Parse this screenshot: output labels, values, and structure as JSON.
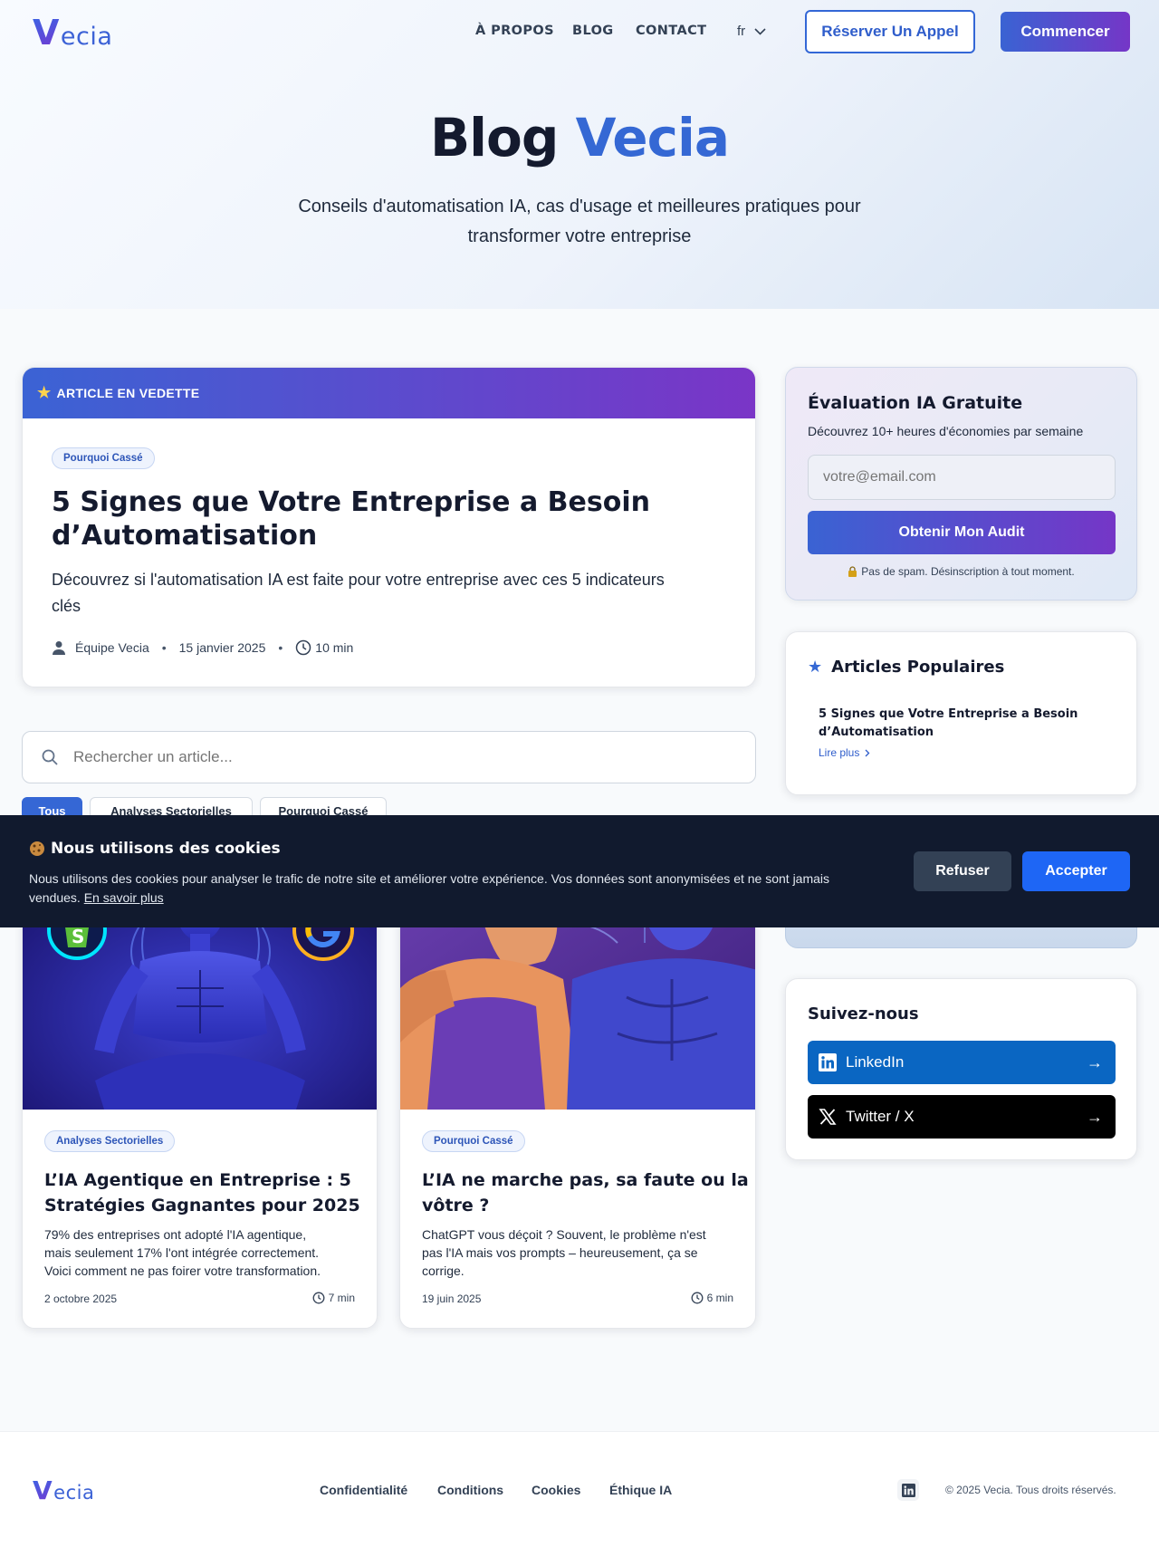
{
  "nav": {
    "logo_initial": "V",
    "logo_text": "ecia",
    "links": [
      "À PROPOS",
      "BLOG",
      "CONTACT"
    ],
    "lang": "fr",
    "book_call": "Réserver Un Appel",
    "start": "Commencer"
  },
  "hero": {
    "title_main": "Blog",
    "title_accent": "Vecia",
    "subtitle_line1": "Conseils d'automatisation IA, cas d'usage et meilleures pratiques pour",
    "subtitle_line2": "transformer votre entreprise"
  },
  "featured": {
    "banner": "ARTICLE EN VEDETTE",
    "category": "Pourquoi Cassé",
    "title_line1": "5 Signes que Votre Entreprise a Besoin",
    "title_line2": "d’Automatisation",
    "excerpt_line1": "Découvrez si l'automatisation IA est faite pour votre entreprise avec ces 5 indicateurs",
    "excerpt_line2": "clés",
    "author": "Équipe Vecia",
    "date": "15 janvier 2025",
    "read_time": "10 min"
  },
  "search": {
    "placeholder": "Rechercher un article..."
  },
  "filters": [
    "Tous",
    "Analyses Sectorielles",
    "Pourquoi Cassé"
  ],
  "articles": [
    {
      "category": "Analyses Sectorielles",
      "title_line1": "L’IA Agentique en Entreprise : 5",
      "title_line2": "Stratégies Gagnantes pour 2025",
      "excerpt_lines": [
        "79% des entreprises ont adopté l'IA agentique,",
        "mais seulement 17% l'ont intégrée correctement.",
        "Voici comment ne pas foirer votre transformation."
      ],
      "date": "2 octobre 2025",
      "read_time": "7 min"
    },
    {
      "category": "Pourquoi Cassé",
      "title_line1": "L’IA ne marche pas, sa faute ou la",
      "title_line2": "vôtre ?",
      "excerpt_lines": [
        "ChatGPT vous déçoit ? Souvent, le problème n'est",
        "pas l'IA mais vos prompts – heureusement, ça se",
        "corrige."
      ],
      "date": "19 juin 2025",
      "read_time": "6 min"
    }
  ],
  "sidebar": {
    "audit": {
      "title": "Évaluation IA Gratuite",
      "subtitle": "Découvrez 10+ heures d'économies par semaine",
      "email_placeholder": "votre@email.com",
      "button": "Obtenir Mon Audit",
      "note": "Pas de spam. Désinscription à tout moment."
    },
    "popular": {
      "title": "Articles Populaires",
      "item_line1": "5 Signes que Votre Entreprise a Besoin",
      "item_line2": "d’Automatisation",
      "read_more": "Lire plus"
    },
    "follow": {
      "title": "Suivez-nous",
      "linkedin": "LinkedIn",
      "twitter": "Twitter / X"
    }
  },
  "cookie": {
    "title": "Nous utilisons des cookies",
    "text_line1": "Nous utilisons des cookies pour analyser le trafic de notre site et améliorer votre expérience. Vos données sont anonymisées et ne sont jamais",
    "text_line2": "vendues.",
    "learn_more": "En savoir plus",
    "refuse": "Refuser",
    "accept": "Accepter"
  },
  "footer": {
    "links": [
      "Confidentialité",
      "Conditions",
      "Cookies",
      "Éthique IA"
    ],
    "copyright": "© 2025 Vecia. Tous droits réservés."
  },
  "colors": {
    "brand_blue": "#3568d4",
    "brand_purple": "#7536c7",
    "cookie_bg": "#111a2e",
    "accept": "#1e66f5",
    "linkedin": "#0a66c2"
  }
}
